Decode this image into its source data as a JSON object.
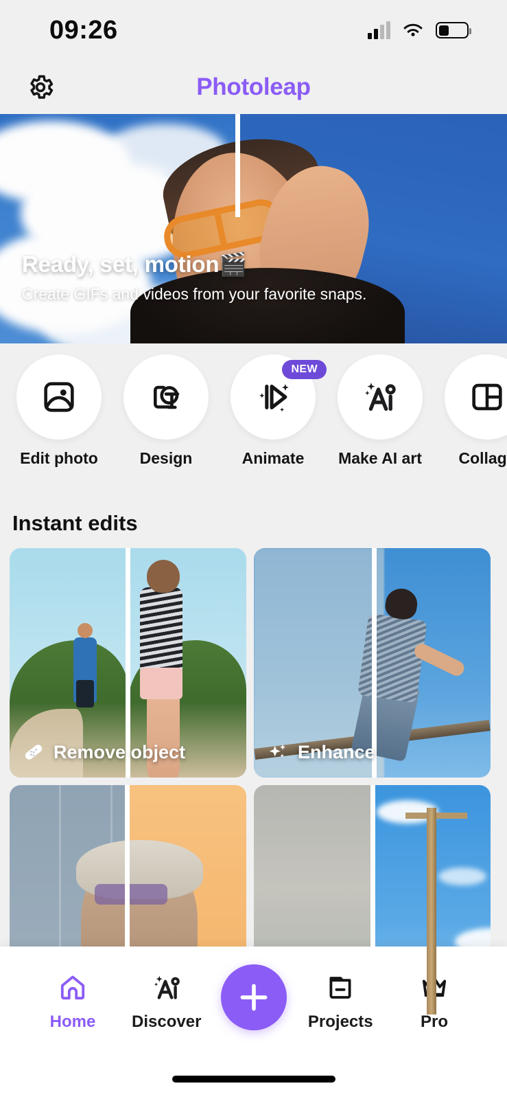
{
  "status_bar": {
    "time": "09:26",
    "signal_icon": "cellular-signal-icon",
    "wifi_icon": "wifi-icon",
    "battery_icon": "battery-icon"
  },
  "header": {
    "title": "Photoleap",
    "settings_icon": "gear-icon",
    "accent_color": "#8b5cf6"
  },
  "hero": {
    "title": "Ready, set, motion🎬",
    "subtitle": "Create GIFs and videos from your favorite snaps."
  },
  "quick_actions": [
    {
      "label": "Edit photo",
      "icon": "photo-icon",
      "badge": ""
    },
    {
      "label": "Design",
      "icon": "design-text-icon",
      "badge": ""
    },
    {
      "label": "Animate",
      "icon": "animate-play-icon",
      "badge": "NEW"
    },
    {
      "label": "Make AI art",
      "icon": "ai-sparkle-icon",
      "badge": ""
    },
    {
      "label": "Collage",
      "icon": "collage-grid-icon",
      "badge": ""
    }
  ],
  "instant_edits": {
    "section_title": "Instant edits",
    "cards": [
      {
        "label": "Remove object",
        "icon": "bandage-icon"
      },
      {
        "label": "Enhance",
        "icon": "sparkles-icon"
      },
      {
        "label": "",
        "icon": ""
      },
      {
        "label": "",
        "icon": ""
      }
    ]
  },
  "bottom_nav": {
    "items": [
      {
        "label": "Home",
        "icon": "home-icon",
        "active": true
      },
      {
        "label": "Discover",
        "icon": "ai-sparkle-icon",
        "active": false
      },
      {
        "label": "Projects",
        "icon": "folder-icon",
        "active": false
      },
      {
        "label": "Pro",
        "icon": "crown-icon",
        "active": false
      }
    ],
    "fab_icon": "plus-icon",
    "active_color": "#8b5cf6"
  }
}
